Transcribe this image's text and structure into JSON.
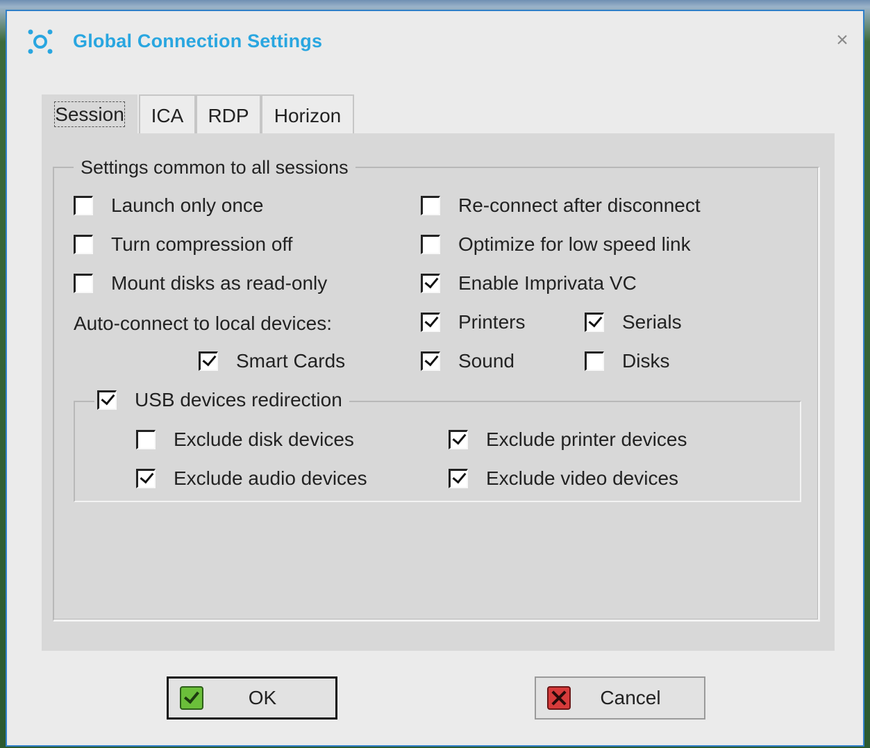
{
  "window": {
    "title": "Global Connection Settings"
  },
  "tabs": [
    {
      "label": "Session",
      "active": true
    },
    {
      "label": "ICA",
      "active": false
    },
    {
      "label": "RDP",
      "active": false
    },
    {
      "label": "Horizon",
      "active": false
    }
  ],
  "group": {
    "legend": "Settings common to all sessions"
  },
  "options": {
    "launch_only_once": {
      "label": "Launch only once",
      "checked": false
    },
    "turn_compression_off": {
      "label": "Turn compression off",
      "checked": false
    },
    "mount_disks_read_only": {
      "label": "Mount disks as read-only",
      "checked": false
    },
    "reconnect_after_disconnect": {
      "label": "Re-connect after disconnect",
      "checked": false
    },
    "optimize_low_speed": {
      "label": "Optimize for low speed link",
      "checked": false
    },
    "enable_imprivata": {
      "label": "Enable Imprivata VC",
      "checked": true
    }
  },
  "autoconnect": {
    "label": "Auto-connect to local devices:",
    "printers": {
      "label": "Printers",
      "checked": true
    },
    "serials": {
      "label": "Serials",
      "checked": true
    },
    "smart_cards": {
      "label": "Smart Cards",
      "checked": true
    },
    "sound": {
      "label": "Sound",
      "checked": true
    },
    "disks": {
      "label": "Disks",
      "checked": false
    }
  },
  "usb": {
    "label": "USB devices redirection",
    "checked": true,
    "exclude_disk": {
      "label": "Exclude disk devices",
      "checked": false
    },
    "exclude_audio": {
      "label": "Exclude audio devices",
      "checked": true
    },
    "exclude_printer": {
      "label": "Exclude printer devices",
      "checked": true
    },
    "exclude_video": {
      "label": "Exclude video devices",
      "checked": true
    }
  },
  "buttons": {
    "ok": "OK",
    "cancel": "Cancel"
  },
  "colors": {
    "title": "#29a6e0",
    "window_border": "#2f7fc8",
    "panel": "#d8d8d8"
  }
}
